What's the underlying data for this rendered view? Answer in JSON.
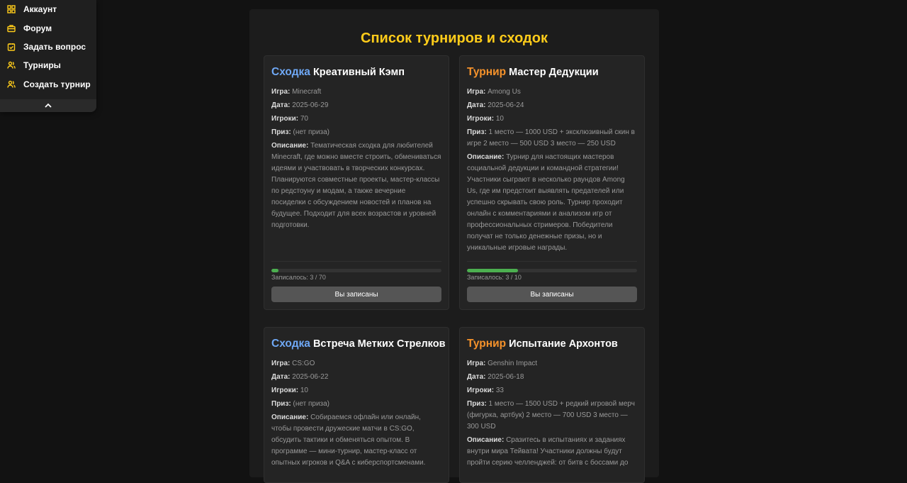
{
  "menu": {
    "items": [
      {
        "label": "Аккаунт",
        "icon": "grid-icon"
      },
      {
        "label": "Форум",
        "icon": "briefcase-icon"
      },
      {
        "label": "Задать вопрос",
        "icon": "clipboard-check-icon"
      },
      {
        "label": "Турниры",
        "icon": "users-icon"
      },
      {
        "label": "Создать турнир",
        "icon": "users-icon"
      }
    ],
    "collapse_icon": "chevron-up-icon"
  },
  "colors": {
    "accent": "#ffcc1a",
    "meetup": "#6fa8f5",
    "tournament": "#f5922b",
    "progress": "#4caf50"
  },
  "page": {
    "title": "Список турниров и сходок"
  },
  "labels": {
    "game": "Игра:",
    "date": "Дата:",
    "players": "Игроки:",
    "prize": "Приз:",
    "description": "Описание:"
  },
  "cards": [
    {
      "kind": "Сходка",
      "name": "Креативный Кэмп",
      "game": "Minecraft",
      "date": "2025-06-29",
      "players": "70",
      "prize": "(нет приза)",
      "description": "Тематическая сходка для любителей Minecraft, где можно вместе строить, обмениваться идеями и участвовать в творческих конкурсах. Планируются совместные проекты, мастер-классы по редстоуну и модам, а также вечерние посиделки с обсуждением новостей и планов на будущее. Подходит для всех возрастов и уровней подготовки.",
      "progress": 0.043,
      "progress_text": "Записалось: 3 / 70",
      "button": "Вы записаны"
    },
    {
      "kind": "Турнир",
      "name": "Мастер Дедукции",
      "game": "Among Us",
      "date": "2025-06-24",
      "players": "10",
      "prize": "1 место — 1000 USD + эксклюзивный скин в игре 2 место — 500 USD 3 место — 250 USD",
      "description": "Турнир для настоящих мастеров социальной дедукции и командной стратегии! Участники сыграют в несколько раундов Among Us, где им предстоит выявлять предателей или успешно скрывать свою роль. Турнир проходит онлайн с комментариями и анализом игр от профессиональных стримеров. Победители получат не только денежные призы, но и уникальные игровые награды.",
      "progress": 0.3,
      "progress_text": "Записалось: 3 / 10",
      "button": "Вы записаны"
    },
    {
      "kind": "Сходка",
      "name": "Встреча Метких Стрелков",
      "game": "CS:GO",
      "date": "2025-06-22",
      "players": "10",
      "prize": "(нет приза)",
      "description": "Собираемся офлайн или онлайн, чтобы провести дружеские матчи в CS:GO, обсудить тактики и обменяться опытом. В программе — мини-турнир, мастер-класс от опытных игроков и Q&A с киберспортсменами."
    },
    {
      "kind": "Турнир",
      "name": "Испытание Архонтов",
      "game": "Genshin Impact",
      "date": "2025-06-18",
      "players": "33",
      "prize": "1 место — 1500 USD + редкий игровой мерч (фигурка, артбук) 2 место — 700 USD 3 место — 300 USD",
      "description": "Сразитесь в испытаниях и заданиях внутри мира Тейвата! Участники должны будут пройти серию челленджей: от битв с боссами до"
    }
  ]
}
